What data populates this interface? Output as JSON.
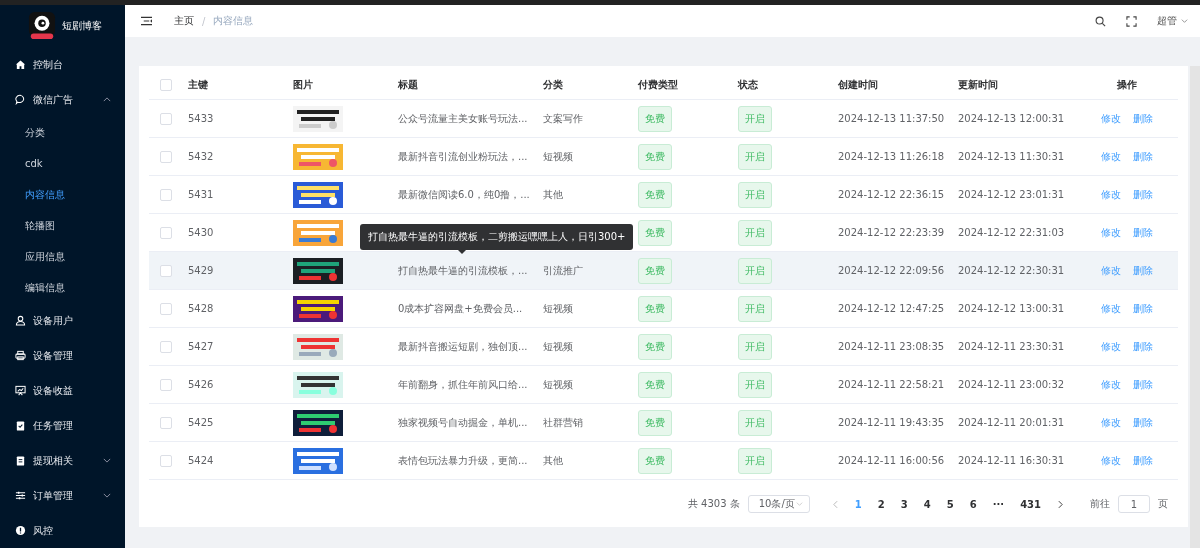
{
  "sidebar": {
    "logo_text": "短剧博客",
    "items": [
      {
        "label": "控制台",
        "selected": false
      },
      {
        "label": "微信广告",
        "selected": false,
        "expanded": true,
        "children": [
          {
            "label": "分类",
            "selected": false
          },
          {
            "label": "cdk",
            "selected": false
          },
          {
            "label": "内容信息",
            "selected": true
          },
          {
            "label": "轮播图",
            "selected": false
          },
          {
            "label": "应用信息",
            "selected": false
          },
          {
            "label": "编辑信息",
            "selected": false
          }
        ]
      },
      {
        "label": "设备用户",
        "selected": false
      },
      {
        "label": "设备管理",
        "selected": false
      },
      {
        "label": "设备收益",
        "selected": false
      },
      {
        "label": "任务管理",
        "selected": false
      },
      {
        "label": "提现相关",
        "selected": false,
        "expanded": false
      },
      {
        "label": "订单管理",
        "selected": false,
        "expanded": false
      },
      {
        "label": "风控",
        "selected": false
      }
    ]
  },
  "header": {
    "breadcrumb": [
      "主页",
      "内容信息"
    ],
    "breadcrumb_separator": "/",
    "user": "超管"
  },
  "table": {
    "all_checked": false,
    "columns": [
      "主键",
      "图片",
      "标题",
      "分类",
      "付费类型",
      "状态",
      "创建时间",
      "更新时间",
      "操作"
    ],
    "rows": [
      {
        "id": "5433",
        "title": "公众号流量主美女账号玩法...",
        "category": "文案写作",
        "pay": "免费",
        "status": "开启",
        "created": "2024-12-13 11:37:50",
        "updated": "2024-12-13 12:00:31",
        "checked": false,
        "hovered": false,
        "actions": [
          "修改",
          "删除"
        ]
      },
      {
        "id": "5432",
        "title": "最新抖音引流创业粉玩法，...",
        "category": "短视频",
        "pay": "免费",
        "status": "开启",
        "created": "2024-12-13 11:26:18",
        "updated": "2024-12-13 11:30:31",
        "checked": false,
        "hovered": false,
        "actions": [
          "修改",
          "删除"
        ]
      },
      {
        "id": "5431",
        "title": "最新微信阅读6.0，纯0撸，...",
        "category": "其他",
        "pay": "免费",
        "status": "开启",
        "created": "2024-12-12 22:36:15",
        "updated": "2024-12-12 23:01:31",
        "checked": false,
        "hovered": false,
        "actions": [
          "修改",
          "删除"
        ]
      },
      {
        "id": "5430",
        "pay": "免费",
        "status": "开启",
        "created": "2024-12-12 22:23:39",
        "updated": "2024-12-12 22:31:03",
        "checked": false,
        "hovered": false,
        "actions": [
          "修改",
          "删除"
        ]
      },
      {
        "id": "5429",
        "title": "打自热最牛逼的引流模板，...",
        "category": "引流推广",
        "pay": "免费",
        "status": "开启",
        "created": "2024-12-12 22:09:56",
        "updated": "2024-12-12 22:30:31",
        "checked": false,
        "hovered": true,
        "tooltip": "打自热最牛逼的引流模板，二剪搬运嘿嘿上人，日引300+",
        "actions": [
          "修改",
          "删除"
        ]
      },
      {
        "id": "5428",
        "title": "0成本扩容网盘+免费会员...",
        "category": "短视频",
        "pay": "免费",
        "status": "开启",
        "created": "2024-12-12 12:47:25",
        "updated": "2024-12-12 13:00:31",
        "checked": false,
        "hovered": false,
        "actions": [
          "修改",
          "删除"
        ]
      },
      {
        "id": "5427",
        "title": "最新抖音搬运短剧，独创顶...",
        "category": "短视频",
        "pay": "免费",
        "status": "开启",
        "created": "2024-12-11 23:08:35",
        "updated": "2024-12-11 23:30:31",
        "checked": false,
        "hovered": false,
        "actions": [
          "修改",
          "删除"
        ]
      },
      {
        "id": "5426",
        "title": "年前翻身，抓住年前风口给...",
        "category": "短视频",
        "pay": "免费",
        "status": "开启",
        "created": "2024-12-11 22:58:21",
        "updated": "2024-12-11 23:00:32",
        "checked": false,
        "hovered": false,
        "actions": [
          "修改",
          "删除"
        ]
      },
      {
        "id": "5425",
        "title": "独家视频号自动掘金，单机...",
        "category": "社群营销",
        "pay": "免费",
        "status": "开启",
        "created": "2024-12-11 19:43:35",
        "updated": "2024-12-11 20:01:31",
        "checked": false,
        "hovered": false,
        "actions": [
          "修改",
          "删除"
        ]
      },
      {
        "id": "5424",
        "title": "表情包玩法暴力升级，更简...",
        "category": "其他",
        "pay": "免费",
        "status": "开启",
        "created": "2024-12-11 16:00:56",
        "updated": "2024-12-11 16:30:31",
        "checked": false,
        "hovered": false,
        "actions": [
          "修改",
          "删除"
        ]
      }
    ]
  },
  "pagination": {
    "total": "共 4303 条",
    "page_size": "10条/页",
    "pages": [
      {
        "label": "1",
        "selected": true
      },
      {
        "label": "2",
        "selected": false
      },
      {
        "label": "3",
        "selected": false
      },
      {
        "label": "4",
        "selected": false
      },
      {
        "label": "5",
        "selected": false
      },
      {
        "label": "6",
        "selected": false
      },
      {
        "label": "···",
        "selected": false
      },
      {
        "label": "431",
        "selected": false
      }
    ],
    "goto_label": "前往",
    "goto_value": "1",
    "goto_suffix": "页"
  }
}
